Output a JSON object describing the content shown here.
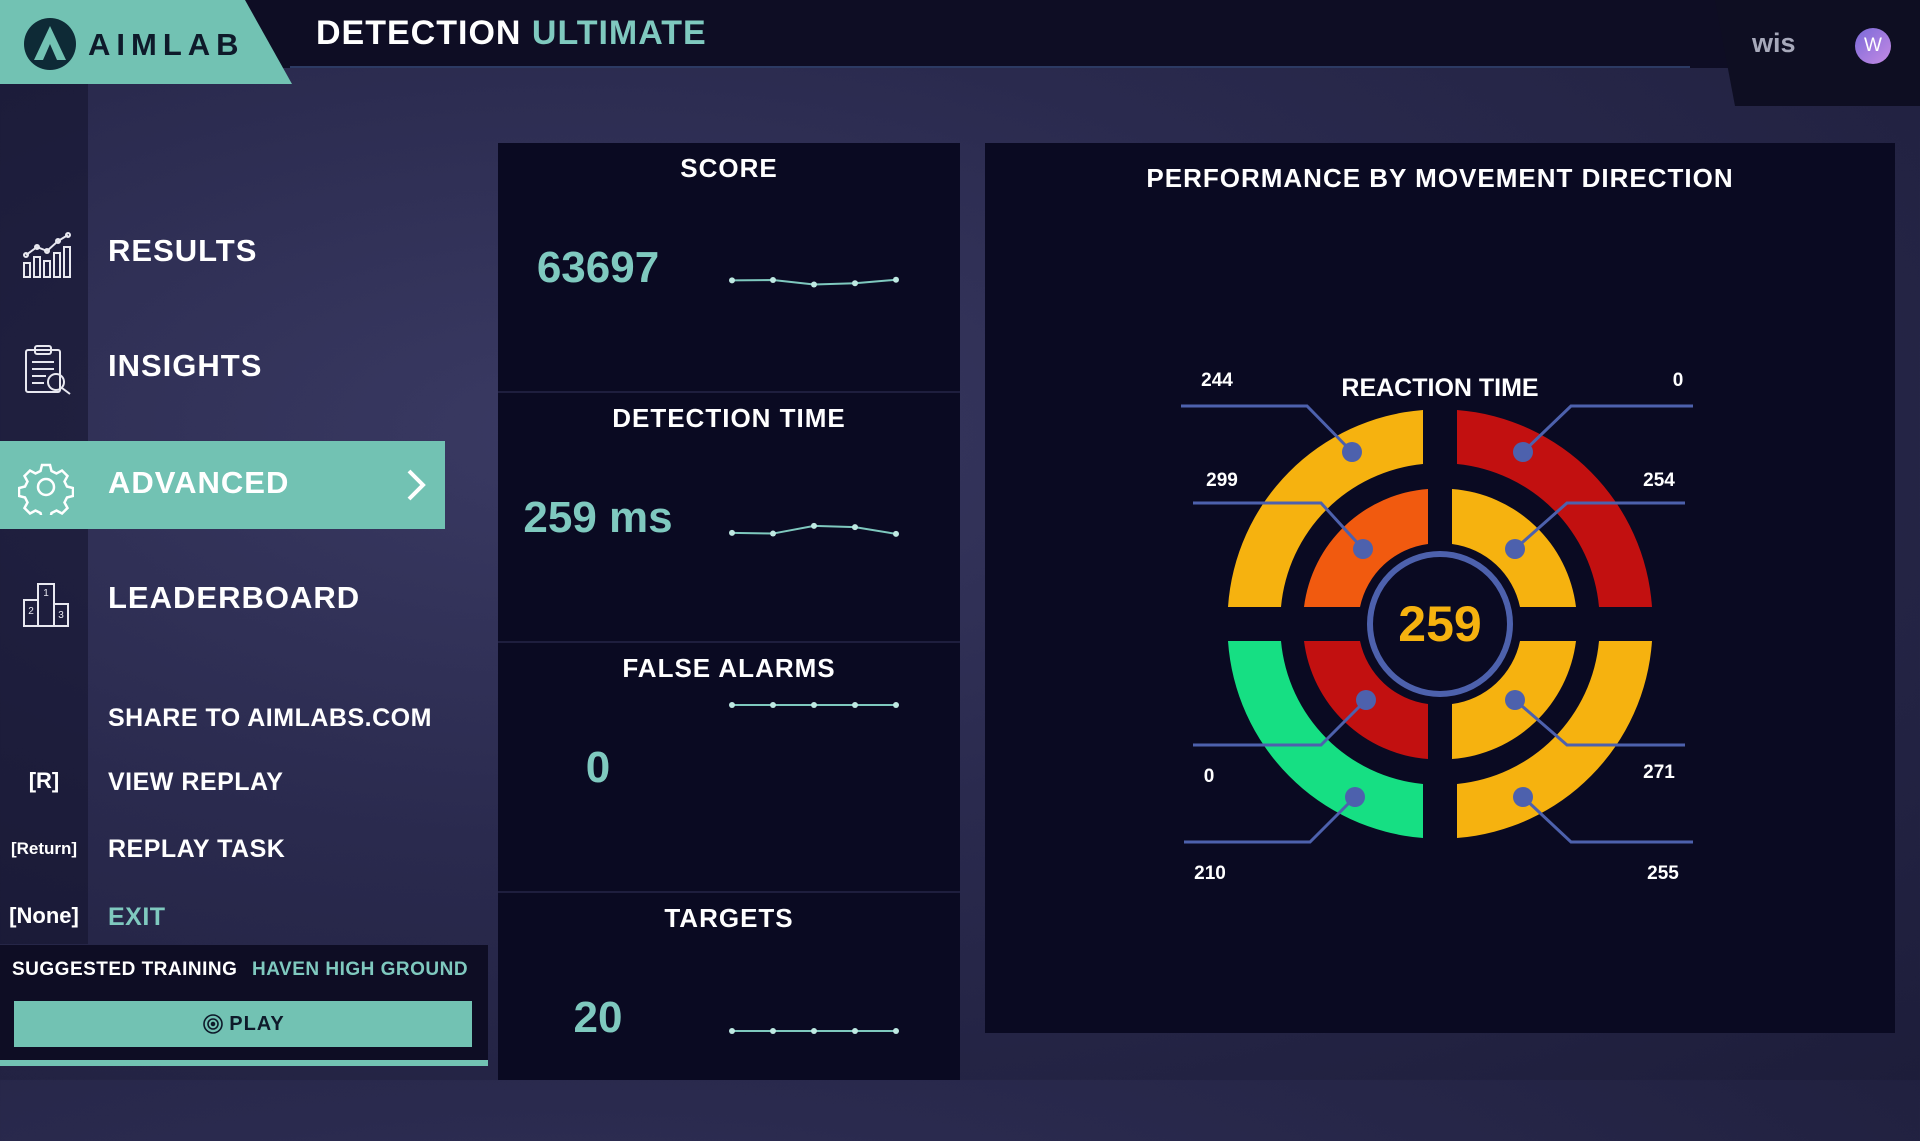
{
  "app": {
    "brand": "AIMLAB",
    "title_main": "DETECTION",
    "title_sub": "ULTIMATE"
  },
  "user": {
    "name": "wis",
    "avatar_letter": "W"
  },
  "nav": [
    {
      "label": "RESULTS",
      "icon": "chart-icon",
      "active": false
    },
    {
      "label": "INSIGHTS",
      "icon": "clipboard-icon",
      "active": false
    },
    {
      "label": "ADVANCED",
      "icon": "gear-icon",
      "active": true
    },
    {
      "label": "LEADERBOARD",
      "icon": "podium-icon",
      "active": false
    }
  ],
  "actions": [
    {
      "key": "",
      "label": "SHARE TO AIMLABS.COM"
    },
    {
      "key": "[R]",
      "label": "VIEW REPLAY"
    },
    {
      "key": "[Return]",
      "label": "REPLAY TASK"
    },
    {
      "key": "[None]",
      "label": "EXIT"
    }
  ],
  "suggested": {
    "label": "SUGGESTED TRAINING",
    "value": "HAVEN HIGH GROUND",
    "play_label": "PLAY"
  },
  "stats": [
    {
      "title": "SCORE",
      "value": "63697",
      "trend": [
        0.52,
        0.53,
        0.39,
        0.43,
        0.54
      ]
    },
    {
      "title": "DETECTION TIME",
      "value": "259 ms",
      "trend": [
        0.44,
        0.42,
        0.66,
        0.62,
        0.41
      ]
    },
    {
      "title": "FALSE ALARMS",
      "value": "0",
      "trend": [
        0.5,
        0.5,
        0.5,
        0.5,
        0.5
      ]
    },
    {
      "title": "TARGETS",
      "value": "20",
      "trend": [
        0.5,
        0.5,
        0.5,
        0.5,
        0.5
      ]
    }
  ],
  "performance": {
    "title": "PERFORMANCE BY MOVEMENT DIRECTION",
    "center_label": "REACTION TIME",
    "center_value": "259",
    "quadrants": {
      "top_left": {
        "outer": 244,
        "inner": 299
      },
      "top_right": {
        "outer": 0,
        "inner": 254
      },
      "bottom_left": {
        "inner": 0,
        "outer": 210
      },
      "bottom_right": {
        "inner": 271,
        "outer": 255
      }
    },
    "colors": {
      "good": "#16df83",
      "fair": "#f6b20f",
      "warn": "#f15a0f",
      "poor": "#c21010",
      "ring": "#4d61ad",
      "center_text": "#f6b20f"
    }
  },
  "colors": {
    "accent": "#72c2b3",
    "teal_text": "#7fc9bf",
    "panel": "#0a0a22"
  }
}
